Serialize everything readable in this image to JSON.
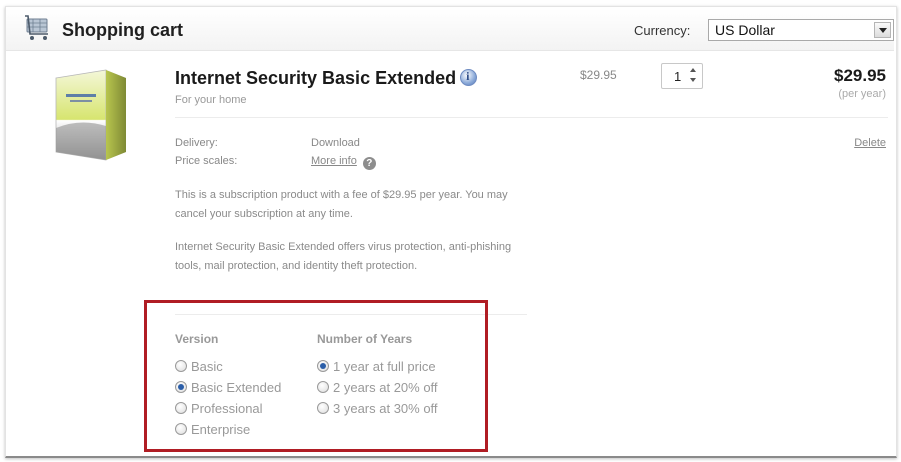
{
  "header": {
    "title": "Shopping cart",
    "icon": "cart-icon",
    "currency_label": "Currency:",
    "currency_value": "US Dollar"
  },
  "product": {
    "name": "Internet Security Basic Extended",
    "subtitle": "For your home",
    "unit_price": "$29.95",
    "quantity": "1",
    "total": "$29.95",
    "total_note": "(per year)",
    "details": {
      "delivery_label": "Delivery:",
      "delivery_value": "Download",
      "price_scales_label": "Price scales:",
      "price_scales_link": "More info"
    },
    "delete_label": "Delete",
    "subscription_text": "This is a subscription product with a fee of $29.95 per year. You may cancel your subscription at any time.",
    "description_text": "Internet Security Basic Extended offers virus protection, anti-phishing tools, mail protection, and identity theft protection."
  },
  "options": {
    "version": {
      "heading": "Version",
      "items": [
        {
          "label": "Basic",
          "checked": false
        },
        {
          "label": "Basic Extended",
          "checked": true
        },
        {
          "label": "Professional",
          "checked": false
        },
        {
          "label": "Enterprise",
          "checked": false
        }
      ]
    },
    "years": {
      "heading": "Number of Years",
      "items": [
        {
          "label": "1 year at full price",
          "checked": true
        },
        {
          "label": "2 years at 20% off",
          "checked": false
        },
        {
          "label": "3 years at 30% off",
          "checked": false
        }
      ]
    }
  },
  "colors": {
    "highlight_border": "#b01d24",
    "radio_selected": "#2b5ea8"
  }
}
